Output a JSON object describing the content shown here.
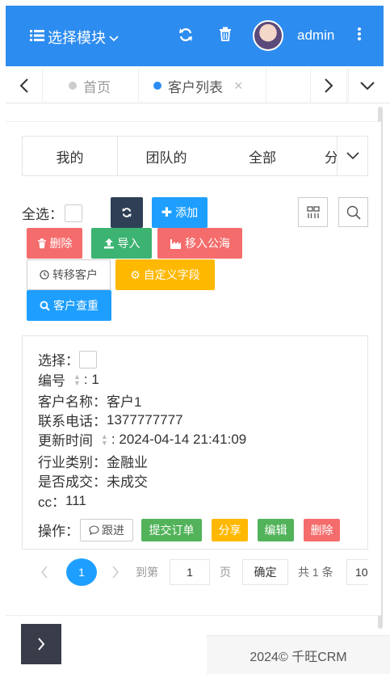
{
  "header": {
    "module_label": "选择模块",
    "username": "admin",
    "colors": {
      "bar": "#2d8cf0"
    },
    "icons": [
      "list-icon",
      "chevron-down-icon",
      "refresh-icon",
      "trash-icon",
      "more-vertical-icon"
    ]
  },
  "tabs": [
    {
      "label": "首页",
      "active": false
    },
    {
      "label": "客户列表",
      "active": true,
      "close": "×"
    }
  ],
  "subtabs": [
    {
      "label": "我的"
    },
    {
      "label": "团队的"
    },
    {
      "label": "全部"
    },
    {
      "label": "分"
    }
  ],
  "toolbar": {
    "select_all_label": "全选：",
    "add_label": "添加",
    "delete_label": "删除",
    "import_label": "导入",
    "move_public_label": "移入公海",
    "transfer_label": "转移客户",
    "custom_field_label": "自定义字段",
    "dup_check_label": "客户查重"
  },
  "record": {
    "select_label": "选择：",
    "id_label": "编号",
    "id_value": ": 1",
    "name_label": "客户名称：",
    "name_value": "客户1",
    "phone_label": "联系电话：",
    "phone_value": "1377777777",
    "updated_label": "更新时间",
    "updated_value": ": 2024-04-14 21:41:09",
    "industry_label": "行业类别：",
    "industry_value": "金融业",
    "deal_label": "是否成交：",
    "deal_value": "未成交",
    "cc_label": "cc：",
    "cc_value": "111",
    "actions_label": "操作：",
    "actions": {
      "follow": "跟进",
      "submit_order": "提交订单",
      "share": "分享",
      "edit": "编辑",
      "delete": "删除"
    }
  },
  "pagination": {
    "current_page": "1",
    "goto_label": "到第",
    "page_input": "1",
    "page_unit": "页",
    "confirm": "确定",
    "total": "共 1 条",
    "page_size": "10"
  },
  "footer": {
    "text": "2024© 千旺CRM"
  }
}
